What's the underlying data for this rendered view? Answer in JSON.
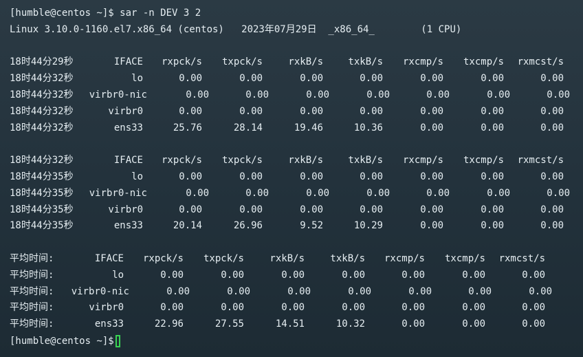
{
  "prompt": "[humble@centos ~]$ sar -n DEV 3 2",
  "sysinfo": "Linux 3.10.0-1160.el7.x86_64 (centos)   2023年07月29日  _x86_64_        (1 CPU)",
  "blocks": [
    {
      "header": {
        "time": "18时44分29秒",
        "cols": [
          "IFACE",
          "rxpck/s",
          "txpck/s",
          "rxkB/s",
          "txkB/s",
          "rxcmp/s",
          "txcmp/s",
          "rxmcst/s"
        ]
      },
      "rows": [
        {
          "time": "18时44分32秒",
          "cols": [
            "lo",
            "0.00",
            "0.00",
            "0.00",
            "0.00",
            "0.00",
            "0.00",
            "0.00"
          ]
        },
        {
          "time": "18时44分32秒",
          "cols": [
            "virbr0-nic",
            "0.00",
            "0.00",
            "0.00",
            "0.00",
            "0.00",
            "0.00",
            "0.00"
          ]
        },
        {
          "time": "18时44分32秒",
          "cols": [
            "virbr0",
            "0.00",
            "0.00",
            "0.00",
            "0.00",
            "0.00",
            "0.00",
            "0.00"
          ]
        },
        {
          "time": "18时44分32秒",
          "cols": [
            "ens33",
            "25.76",
            "28.14",
            "19.46",
            "10.36",
            "0.00",
            "0.00",
            "0.00"
          ]
        }
      ]
    },
    {
      "header": {
        "time": "18时44分32秒",
        "cols": [
          "IFACE",
          "rxpck/s",
          "txpck/s",
          "rxkB/s",
          "txkB/s",
          "rxcmp/s",
          "txcmp/s",
          "rxmcst/s"
        ]
      },
      "rows": [
        {
          "time": "18时44分35秒",
          "cols": [
            "lo",
            "0.00",
            "0.00",
            "0.00",
            "0.00",
            "0.00",
            "0.00",
            "0.00"
          ]
        },
        {
          "time": "18时44分35秒",
          "cols": [
            "virbr0-nic",
            "0.00",
            "0.00",
            "0.00",
            "0.00",
            "0.00",
            "0.00",
            "0.00"
          ]
        },
        {
          "time": "18时44分35秒",
          "cols": [
            "virbr0",
            "0.00",
            "0.00",
            "0.00",
            "0.00",
            "0.00",
            "0.00",
            "0.00"
          ]
        },
        {
          "time": "18时44分35秒",
          "cols": [
            "ens33",
            "20.14",
            "26.96",
            "9.52",
            "10.29",
            "0.00",
            "0.00",
            "0.00"
          ]
        }
      ]
    },
    {
      "header": {
        "time": "平均时间:",
        "cols": [
          "IFACE",
          "rxpck/s",
          "txpck/s",
          "rxkB/s",
          "txkB/s",
          "rxcmp/s",
          "txcmp/s",
          "rxmcst/s"
        ]
      },
      "rows": [
        {
          "time": "平均时间:",
          "cols": [
            "lo",
            "0.00",
            "0.00",
            "0.00",
            "0.00",
            "0.00",
            "0.00",
            "0.00"
          ]
        },
        {
          "time": "平均时间:",
          "cols": [
            "virbr0-nic",
            "0.00",
            "0.00",
            "0.00",
            "0.00",
            "0.00",
            "0.00",
            "0.00"
          ]
        },
        {
          "time": "平均时间:",
          "cols": [
            "virbr0",
            "0.00",
            "0.00",
            "0.00",
            "0.00",
            "0.00",
            "0.00",
            "0.00"
          ]
        },
        {
          "time": "平均时间:",
          "cols": [
            "ens33",
            "22.96",
            "27.55",
            "14.51",
            "10.32",
            "0.00",
            "0.00",
            "0.00"
          ]
        }
      ]
    }
  ],
  "final_prompt": "[humble@centos ~]$",
  "colors": {
    "background": "#26353f",
    "text": "#e6eef2",
    "cursor": "#39d353"
  }
}
